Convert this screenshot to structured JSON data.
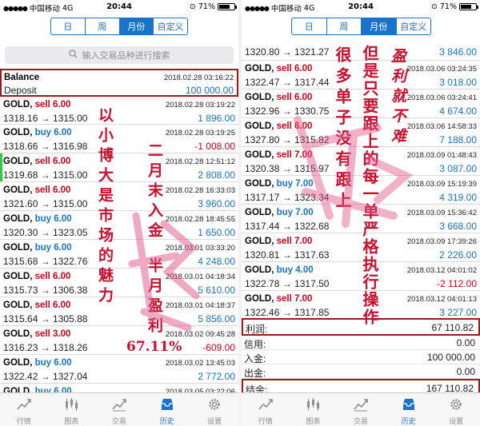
{
  "left": {
    "status": {
      "carrier": "中国移动",
      "network": "4G",
      "time": "20:44",
      "battery": "71%",
      "battery_level": 0.71
    },
    "tabs": [
      {
        "label": "日",
        "active": false
      },
      {
        "label": "周",
        "active": false
      },
      {
        "label": "月份",
        "active": true
      },
      {
        "label": "自定义",
        "active": false
      }
    ],
    "search_placeholder": "输入交易品种进行搜索",
    "balance": {
      "title": "Balance",
      "date": "2018.02.28 03:16:22",
      "subtitle": "Deposit",
      "amount": "100 000.00"
    },
    "rows": [
      {
        "symbol": "GOLD,",
        "dir": "sell 6.00",
        "type": "sell",
        "date": "2018.02.28 03:19:22",
        "prices": "1318.16 → 1315.00",
        "profit": "1 896.00",
        "sign": "pos"
      },
      {
        "symbol": "GOLD,",
        "dir": "buy 6.00",
        "type": "buy",
        "date": "2018.02.28 03:19:25",
        "prices": "1318.66 → 1316.98",
        "profit": "-1 008.00",
        "sign": "neg"
      },
      {
        "symbol": "GOLD,",
        "dir": "sell 6.00",
        "type": "sell",
        "date": "2018.02.28 12:51:12",
        "prices": "1319.68 → 1315.00",
        "profit": "2 808.00",
        "sign": "pos"
      },
      {
        "symbol": "GOLD,",
        "dir": "sell 6.00",
        "type": "sell",
        "date": "2018.02.28 16:33:03",
        "prices": "1321.60 → 1315.00",
        "profit": "3 960.00",
        "sign": "pos"
      },
      {
        "symbol": "GOLD,",
        "dir": "buy 6.00",
        "type": "buy",
        "date": "2018.02.28 18:45:55",
        "prices": "1320.30 → 1323.05",
        "profit": "1 650.00",
        "sign": "pos"
      },
      {
        "symbol": "GOLD,",
        "dir": "buy 6.00",
        "type": "buy",
        "date": "2018.03.01 03:33:20",
        "prices": "1315.68 → 1322.76",
        "profit": "4 248.00",
        "sign": "pos"
      },
      {
        "symbol": "GOLD,",
        "dir": "sell 6.00",
        "type": "sell",
        "date": "2018.03.01 04:18:34",
        "prices": "1315.73 → 1306.38",
        "profit": "5 610.00",
        "sign": "pos"
      },
      {
        "symbol": "GOLD,",
        "dir": "sell 6.00",
        "type": "sell",
        "date": "2018.03.01 04:18:37",
        "prices": "1315.64 → 1305.88",
        "profit": "5 856.00",
        "sign": "pos"
      },
      {
        "symbol": "GOLD,",
        "dir": "sell 3.00",
        "type": "sell",
        "date": "2018.03.02 09:45:28",
        "prices": "1316.23 → 1318.26",
        "profit": "-609.00",
        "sign": "neg"
      },
      {
        "symbol": "GOLD,",
        "dir": "buy 6.00",
        "type": "buy",
        "date": "2018.03.02 13:45:03",
        "prices": "1322.42 → 1327.04",
        "profit": "2 772.00",
        "sign": "pos"
      },
      {
        "symbol": "GOLD,",
        "dir": "buy 6.00",
        "type": "buy",
        "date": "2018.03.05 03:22:06",
        "prices": "",
        "profit": "",
        "sign": "pos"
      }
    ],
    "overlay": {
      "col1": "以小博大是市场的魅力",
      "col2": "二月末入金",
      "col3": "半月盈利",
      "percent": "67.11%"
    }
  },
  "right": {
    "status": {
      "carrier": "中国移动",
      "network": "4G",
      "time": "20:44",
      "battery": "71%",
      "battery_level": 0.71
    },
    "tabs": [
      {
        "label": "日",
        "active": false
      },
      {
        "label": "周",
        "active": false
      },
      {
        "label": "月份",
        "active": true
      },
      {
        "label": "自定义",
        "active": false
      }
    ],
    "rows": [
      {
        "symbol": "",
        "dir": "",
        "type": "buy",
        "date": "",
        "prices": "1320.80 → 1321.27",
        "profit": "3 846.00",
        "sign": "pos"
      },
      {
        "symbol": "GOLD,",
        "dir": "sell 6.00",
        "type": "sell",
        "date": "2018.03.06 03:24:35",
        "prices": "1322.47 → 1317.44",
        "profit": "3 018.00",
        "sign": "pos"
      },
      {
        "symbol": "GOLD,",
        "dir": "sell 6.00",
        "type": "sell",
        "date": "2018.03.06 03:24:41",
        "prices": "1322.96 → 1330.75",
        "profit": "4 674.00",
        "sign": "pos"
      },
      {
        "symbol": "GOLD,",
        "dir": "sell 6.00",
        "type": "sell",
        "date": "2018.03.06 14:58:33",
        "prices": "1327.80 → 1315.82",
        "profit": "7 188.00",
        "sign": "pos"
      },
      {
        "symbol": "GOLD,",
        "dir": "sell 7.00",
        "type": "sell",
        "date": "2018.03.09 01:48:43",
        "prices": "1320.38 → 1315.97",
        "profit": "3 087.00",
        "sign": "pos"
      },
      {
        "symbol": "GOLD,",
        "dir": "buy 7.00",
        "type": "buy",
        "date": "2018.03.09 15:19:39",
        "prices": "1317.17 → 1323.34",
        "profit": "4 319.00",
        "sign": "pos"
      },
      {
        "symbol": "GOLD,",
        "dir": "buy 7.00",
        "type": "buy",
        "date": "2018.03.09 15:36:42",
        "prices": "1317.44 → 1322.68",
        "profit": "3 668.00",
        "sign": "pos"
      },
      {
        "symbol": "GOLD,",
        "dir": "sell 7.00",
        "type": "sell",
        "date": "2018.03.09 17:39:26",
        "prices": "1320.81 → 1317.63",
        "profit": "2 226.00",
        "sign": "pos"
      },
      {
        "symbol": "GOLD,",
        "dir": "buy 4.00",
        "type": "buy",
        "date": "2018.03.12 04:01:02",
        "prices": "1322.78 → 1317.50",
        "profit": "-2 112.00",
        "sign": "neg"
      },
      {
        "symbol": "GOLD,",
        "dir": "sell 7.00",
        "type": "sell",
        "date": "2018.03.12 04:01:13",
        "prices": "1322.46 → 1317.85",
        "profit": "3 227.00",
        "sign": "pos"
      }
    ],
    "summary": [
      {
        "label": "利润:",
        "value": "67 110.82",
        "boxed": true
      },
      {
        "label": "信用:",
        "value": "0.00",
        "boxed": false
      },
      {
        "label": "入金:",
        "value": "100 000.00",
        "boxed": false
      },
      {
        "label": "出金:",
        "value": "0.00",
        "boxed": false
      },
      {
        "label": "结余:",
        "value": "167 110.82",
        "boxed": true
      }
    ],
    "overlay": {
      "col1": "很多单子没有跟上",
      "col2": "但是只要跟上的每一单严格执行操作",
      "col3": "盈利就不难"
    }
  },
  "nav": [
    {
      "label": "行情",
      "icon": "quotes-icon",
      "active": false
    },
    {
      "label": "图表",
      "icon": "chart-icon",
      "active": false
    },
    {
      "label": "交易",
      "icon": "trade-icon",
      "active": false
    },
    {
      "label": "历史",
      "icon": "history-icon",
      "active": true
    },
    {
      "label": "设置",
      "icon": "settings-icon",
      "active": false
    }
  ],
  "colors": {
    "accent": "#1a73c8",
    "sell": "#d0021b",
    "buy": "#1a73c8",
    "overlay": "#c8102e",
    "highlight_box": "#9b1b1b"
  }
}
